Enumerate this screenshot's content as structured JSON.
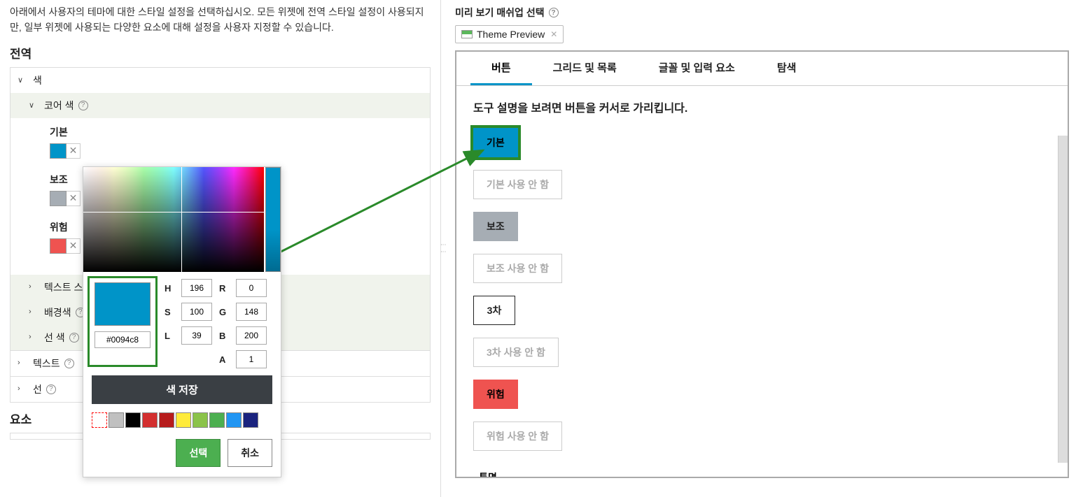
{
  "left": {
    "description": "아래에서 사용자의 테마에 대한 스타일 설정을 선택하십시오. 모든 위젯에 전역 스타일 설정이 사용되지만, 일부 위젯에 사용되는 다양한 요소에 대해 설정을 사용자 지정할 수 있습니다.",
    "section_global": "전역",
    "acc_color": "색",
    "acc_core": "코어 색",
    "core": {
      "primary_label": "기본",
      "secondary_label": "보조",
      "danger_label": "위험",
      "primary_color": "#0094c8",
      "secondary_color": "#a6adb4",
      "danger_color": "#ef5350"
    },
    "acc_text_style": "텍스트 스",
    "acc_bg": "배경색",
    "acc_line_color": "선 색",
    "acc_text": "텍스트",
    "acc_line": "선",
    "section_elements": "요소"
  },
  "picker": {
    "hex": "#0094c8",
    "H": "196",
    "S": "100",
    "L": "39",
    "R": "0",
    "G": "148",
    "B": "200",
    "A": "1",
    "save": "색 저장",
    "select": "선택",
    "cancel": "취소",
    "palette": [
      "",
      "#c0c0c0",
      "#000000",
      "#d32f2f",
      "#b71c1c",
      "#ffeb3b",
      "#8bc34a",
      "#4caf50",
      "#2196f3",
      "#1a237e"
    ]
  },
  "right": {
    "header": "미리 보기 매쉬업 선택",
    "chip": "Theme Preview",
    "tabs": [
      "버튼",
      "그리드 및 목록",
      "글꼴 및 입력 요소",
      "탐색"
    ],
    "hint": "도구 설명을 보려면 버튼을 커서로 가리킵니다.",
    "buttons": {
      "primary": "기본",
      "primary_disabled": "기본 사용 안 함",
      "secondary": "보조",
      "secondary_disabled": "보조 사용 안 함",
      "tertiary": "3차",
      "tertiary_disabled": "3차 사용 안 함",
      "danger": "위험",
      "danger_disabled": "위험 사용 안 함",
      "transparent": "투명"
    }
  }
}
